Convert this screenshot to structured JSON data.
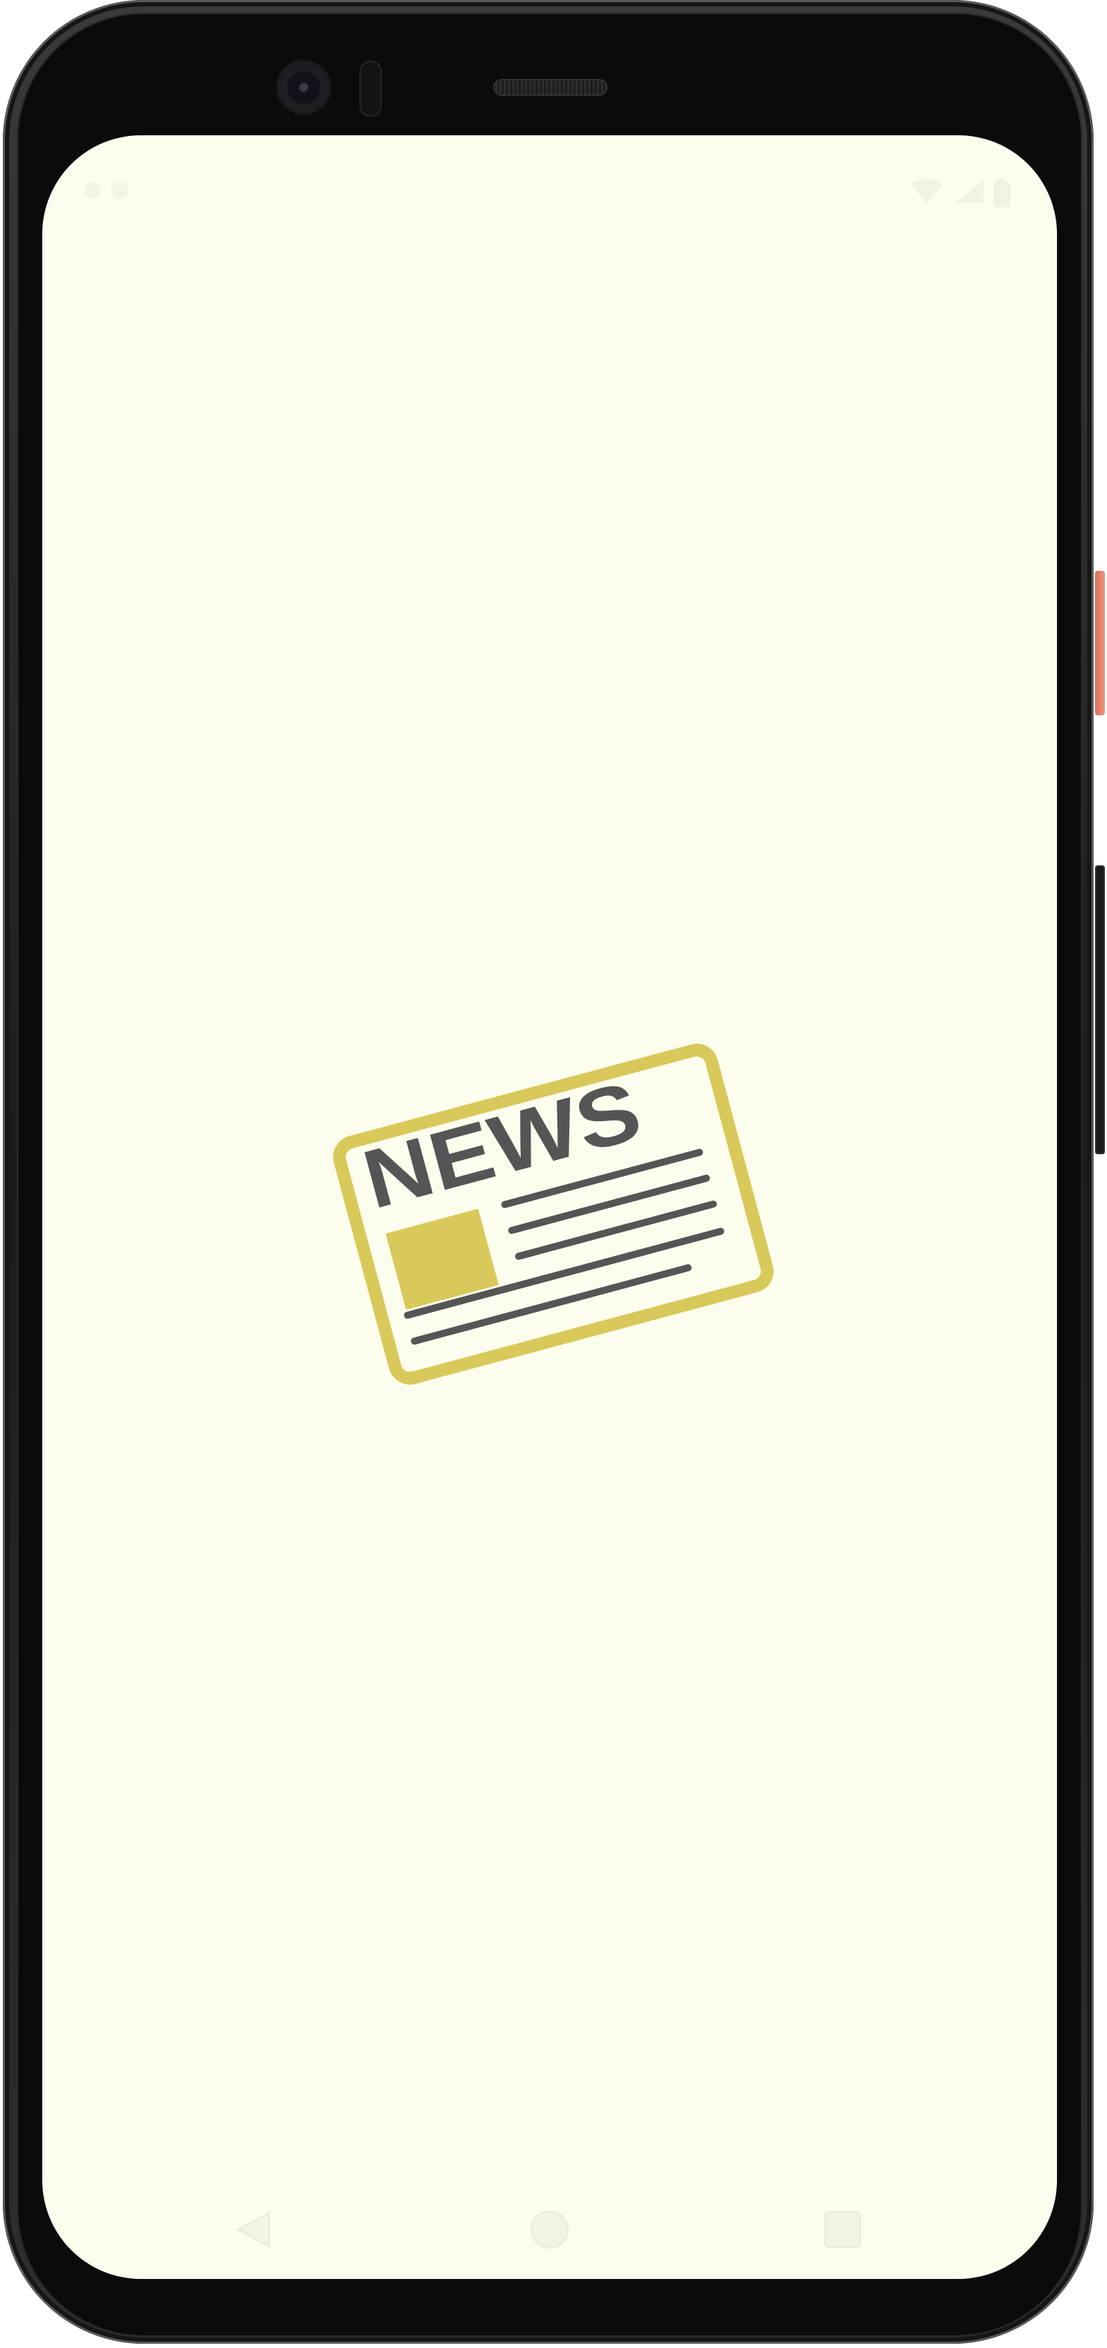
{
  "app": {
    "name": "News",
    "screen": "splash"
  },
  "splash": {
    "logo_text": "NEWS",
    "logo_icon": "newspaper-icon"
  },
  "status_bar": {
    "icons": [
      "wifi-icon",
      "signal-icon",
      "battery-icon"
    ]
  },
  "navigation_bar": {
    "buttons": [
      "back-button",
      "home-button",
      "recents-button"
    ]
  },
  "colors": {
    "screen_background": "#fdfdee",
    "logo_accent": "#d9c95a",
    "logo_ink": "#555555",
    "device_frame": "#0b0b0c",
    "power_button": "#e8806a"
  }
}
